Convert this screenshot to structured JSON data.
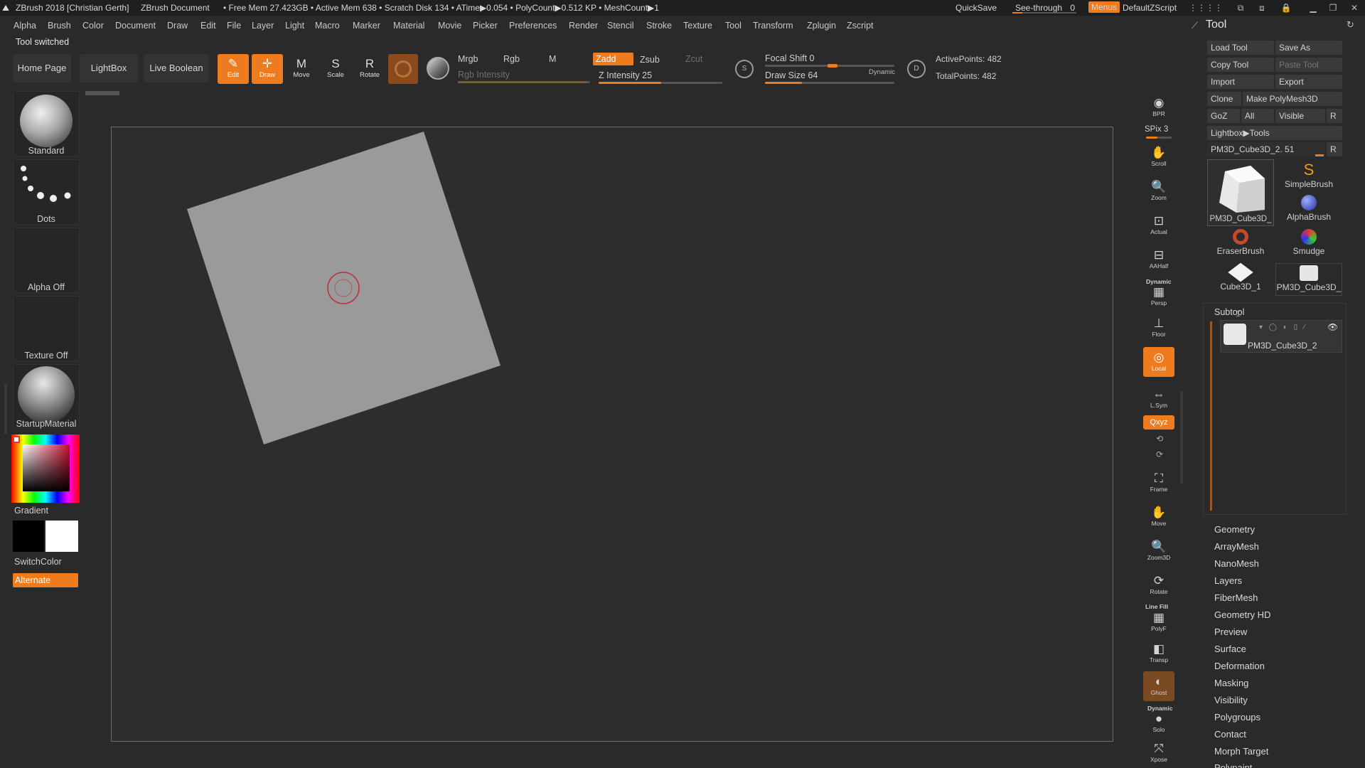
{
  "titlebar": {
    "app": "ZBrush 2018 [Christian Gerth]",
    "document": "ZBrush Document",
    "stats": "• Free Mem 27.423GB • Active Mem 638 • Scratch Disk 134 • ATime▶0.054 • PolyCount▶0.512 KP • MeshCount▶1",
    "quicksave": "QuickSave",
    "see_through": "See-through",
    "see_through_value": "0",
    "menus": "Menus",
    "script": "DefaultZScript"
  },
  "menu": [
    "Alpha",
    "Brush",
    "Color",
    "Document",
    "Draw",
    "Edit",
    "File",
    "Layer",
    "Light",
    "Macro",
    "Marker",
    "Material",
    "Movie",
    "Picker",
    "Preferences",
    "Render",
    "Stencil",
    "Stroke",
    "Texture",
    "Tool",
    "Transform",
    "Zplugin",
    "Zscript"
  ],
  "status": "Tool switched",
  "nav": {
    "home": "Home Page",
    "lightbox": "LightBox",
    "live_boolean": "Live Boolean"
  },
  "transform_buttons": [
    {
      "label": "Edit",
      "glyph": "✎",
      "on": true
    },
    {
      "label": "Draw",
      "glyph": "✛",
      "on": true
    },
    {
      "label": "Move",
      "glyph": "M",
      "on": false
    },
    {
      "label": "Scale",
      "glyph": "S",
      "on": false
    },
    {
      "label": "Rotate",
      "glyph": "R",
      "on": false
    }
  ],
  "modes": {
    "mrgb": "Mrgb",
    "rgb": "Rgb",
    "m": "M",
    "zadd": "Zadd",
    "zsub": "Zsub",
    "zcut": "Zcut",
    "rgb_intensity": "Rgb Intensity",
    "z_intensity": "Z Intensity 25"
  },
  "brush": {
    "focal_shift": "Focal Shift 0",
    "draw_size": "Draw Size 64",
    "dynamic": "Dynamic",
    "active_points": "ActivePoints: 482",
    "total_points": "TotalPoints: 482"
  },
  "left_shelf": {
    "brush": "Standard",
    "stroke": "Dots",
    "alpha": "Alpha Off",
    "texture": "Texture Off",
    "material": "StartupMaterial",
    "gradient": "Gradient",
    "switch_color": "SwitchColor",
    "alternate": "Alternate"
  },
  "right_shelf": [
    {
      "label": "BPR",
      "glyph": "◉"
    },
    {
      "label": "SPix 3",
      "glyph": ""
    },
    {
      "label": "Scroll",
      "glyph": "✋"
    },
    {
      "label": "Zoom",
      "glyph": "🔍"
    },
    {
      "label": "Actual",
      "glyph": "⊡"
    },
    {
      "label": "AAHalf",
      "glyph": "⊟"
    },
    {
      "label": "Persp",
      "glyph": "▦"
    },
    {
      "label": "Floor",
      "glyph": "⊥"
    },
    {
      "label": "Local",
      "glyph": "◎"
    },
    {
      "label": "L.Sym",
      "glyph": "⇔"
    },
    {
      "label": "Qxyz",
      "glyph": ""
    },
    {
      "label": "Frame",
      "glyph": "⛶"
    },
    {
      "label": "Move",
      "glyph": "✋"
    },
    {
      "label": "Zoom3D",
      "glyph": "🔍"
    },
    {
      "label": "Rotate",
      "glyph": "⟳"
    },
    {
      "label": "PolyF",
      "glyph": "▦"
    },
    {
      "label": "Transp",
      "glyph": "◧"
    },
    {
      "label": "Ghost",
      "glyph": "◐"
    },
    {
      "label": "Solo",
      "glyph": "●"
    },
    {
      "label": "Xpose",
      "glyph": "⤧"
    }
  ],
  "right_shelf_extra": {
    "dynamic": "Dynamic",
    "line_fill": "Line Fill",
    "dynamic2": "Dynamic"
  },
  "palette": {
    "title": "Tool",
    "buttons": {
      "load_tool": "Load Tool",
      "save_as": "Save As",
      "copy_tool": "Copy Tool",
      "paste_tool": "Paste Tool",
      "import": "Import",
      "export": "Export",
      "clone": "Clone",
      "make_polymesh": "Make PolyMesh3D",
      "goz": "GoZ",
      "all": "All",
      "visible": "Visible",
      "r": "R",
      "lightbox_tools": "Lightbox▶Tools"
    },
    "current_tool": "PM3D_Cube3D_2. 51",
    "current_tool_r": "R",
    "tools": [
      "PM3D_Cube3D_",
      "SimpleBrush",
      "AlphaBrush",
      "EraserBrush",
      "Smudge",
      "Cube3D_1",
      "PM3D_Cube3D_"
    ],
    "subtool_title": "Subtool",
    "subtool_name": "PM3D_Cube3D_2",
    "sections": [
      "Geometry",
      "ArrayMesh",
      "NanoMesh",
      "Layers",
      "FiberMesh",
      "Geometry HD",
      "Preview",
      "Surface",
      "Deformation",
      "Masking",
      "Visibility",
      "Polygroups",
      "Contact",
      "Morph Target",
      "Polypaint"
    ]
  },
  "colors": {
    "accent": "#ee7b1d",
    "panel": "#2a2a2a",
    "canvas": "#2d2d2d",
    "cube_face": "#9a9a9a",
    "cursor": "#c0303a"
  }
}
